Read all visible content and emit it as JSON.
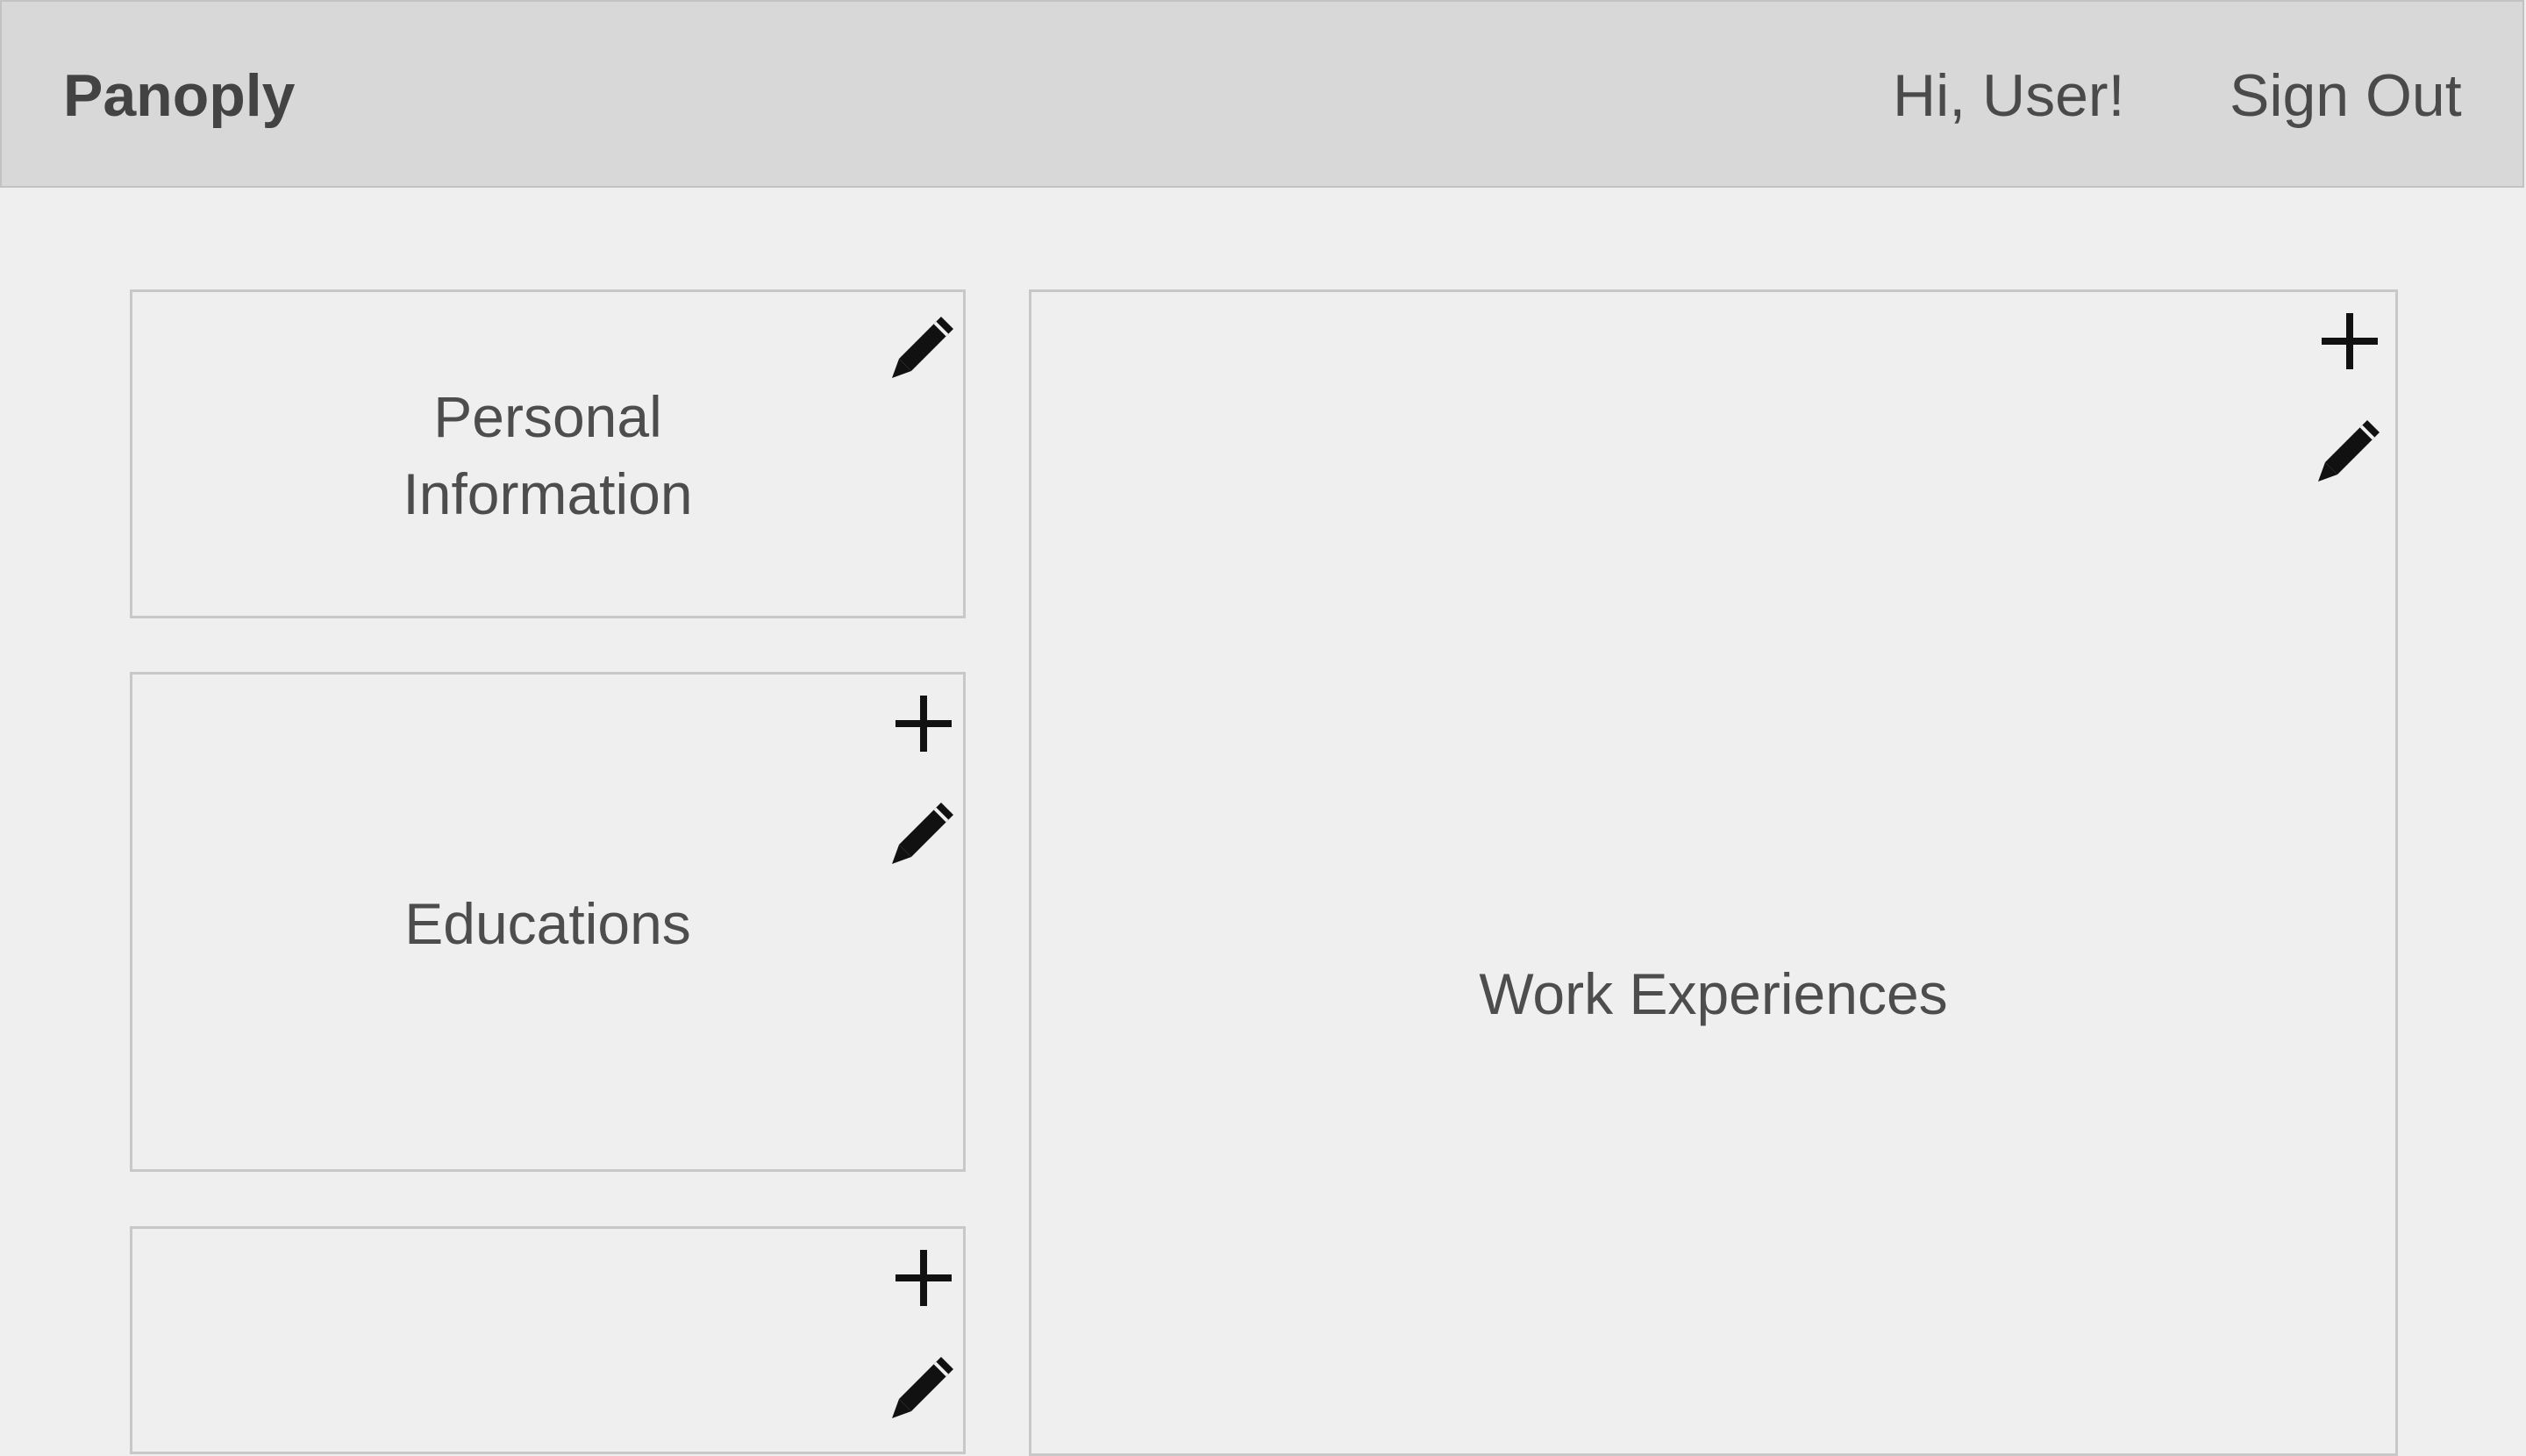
{
  "header": {
    "brand": "Panoply",
    "greeting": "Hi, User!",
    "sign_out": "Sign Out"
  },
  "cards": {
    "personal": {
      "title_line1": "Personal",
      "title_line2": "Information"
    },
    "educations": {
      "title": "Educations"
    },
    "third": {
      "title": ""
    },
    "work": {
      "title": "Work Experiences"
    }
  },
  "icons": {
    "add": "plus-icon",
    "edit": "pencil-icon"
  },
  "colors": {
    "header_bg": "#d8d8d8",
    "page_bg": "#efefef",
    "border": "#c8c8c8",
    "text": "#4d4d4d",
    "icon": "#111111"
  }
}
